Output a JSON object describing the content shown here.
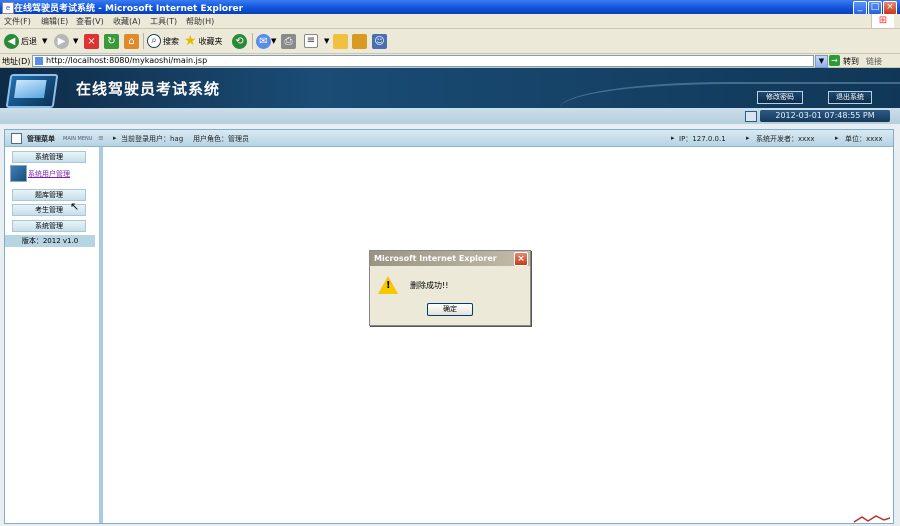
{
  "window": {
    "title": "在线驾驶员考试系统 - Microsoft Internet Explorer",
    "icon": "ie-page-icon"
  },
  "menubar": {
    "items": [
      "文件(F)",
      "编辑(E)",
      "查看(V)",
      "收藏(A)",
      "工具(T)",
      "帮助(H)"
    ]
  },
  "toolbar": {
    "back_label": "后退",
    "search_label": "搜索",
    "favorites_label": "收藏夹"
  },
  "address": {
    "label": "地址(D)",
    "url": "http://localhost:8080/mykaoshi/main.jsp",
    "go_label": "转到",
    "links_label": "链接"
  },
  "banner": {
    "title": "在线驾驶员考试系统",
    "change_password": "修改密码",
    "logout": "退出系统",
    "datetime": "2012-03-01 07:48:55 PM"
  },
  "panelbar": {
    "menu_title": "管理菜单",
    "menu_title_en": "MAIN MENU",
    "current_user": "当前登录用户：hag",
    "user_role": "用户角色：管理员",
    "ip": "IP：127.0.0.1",
    "developer": "系统开发者：xxxx",
    "unit": "单位：xxxx"
  },
  "sidebar": {
    "items": [
      {
        "label": "系统管理"
      },
      {
        "label": "系统用户管理"
      },
      {
        "label": "题库管理"
      },
      {
        "label": "考生管理"
      },
      {
        "label": "系统管理"
      }
    ],
    "version": "版本：2012 v1.0"
  },
  "dialog": {
    "title": "Microsoft Internet Explorer",
    "message": "删除成功!!",
    "ok_label": "确定"
  },
  "colors": {
    "title_bar": "#0d52d9",
    "banner": "#1a4c75",
    "panel_header": "#b5d3e2",
    "warning": "#f5c800"
  }
}
